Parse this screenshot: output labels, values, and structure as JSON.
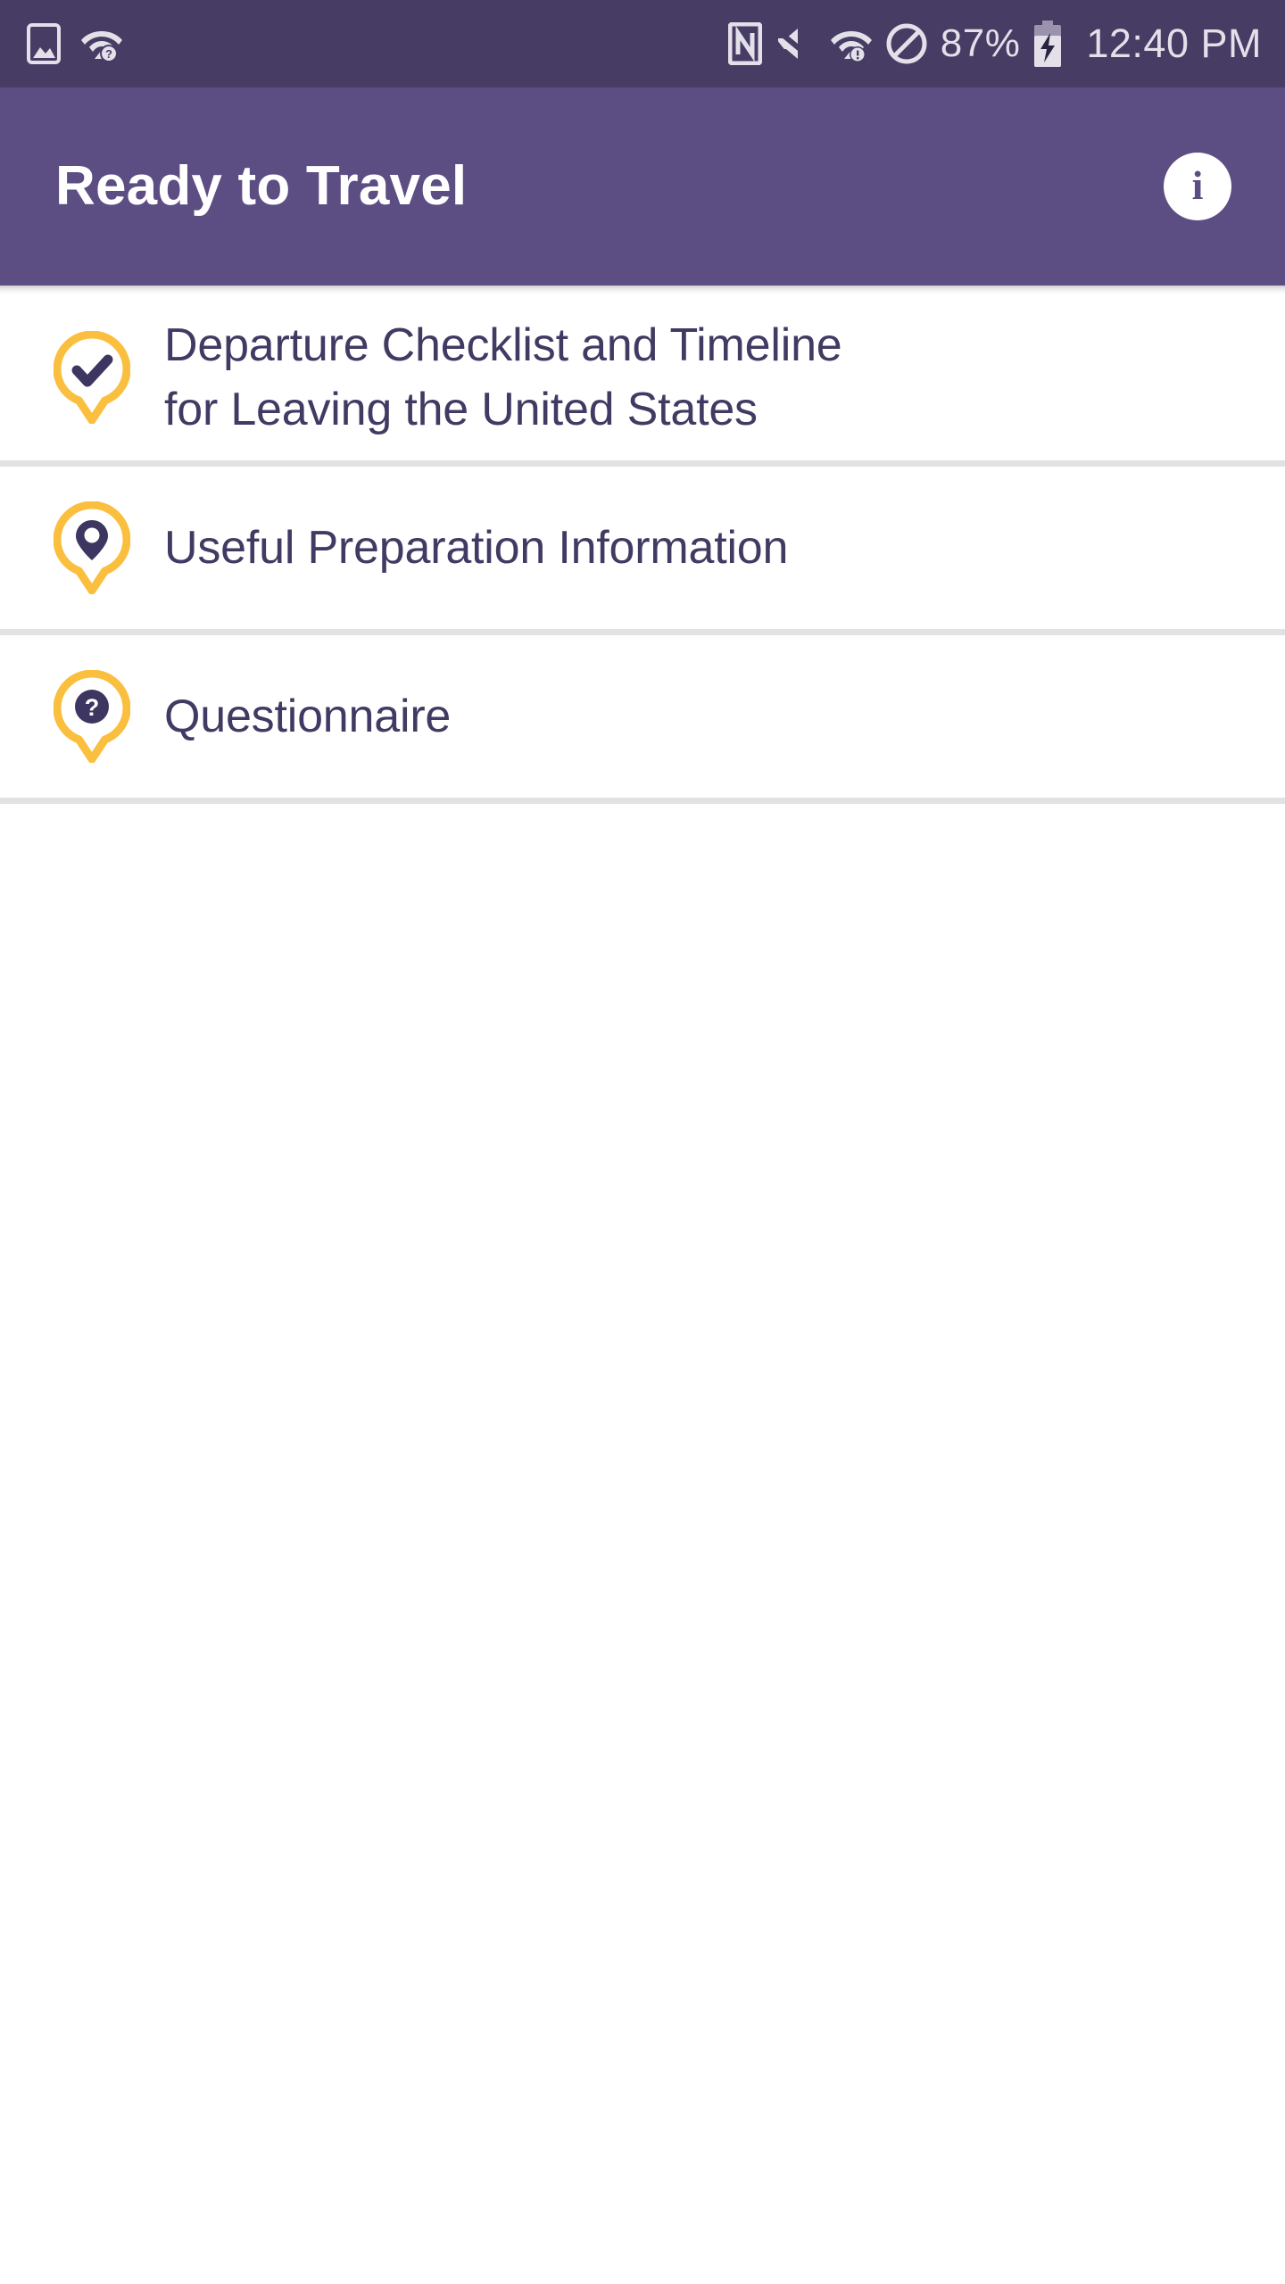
{
  "status_bar": {
    "left_icons": [
      {
        "name": "photo-image-icon",
        "label": "image"
      },
      {
        "name": "wifi-question-icon",
        "label": "wifi-help"
      }
    ],
    "right_icons": [
      {
        "name": "nfc-icon",
        "label": "NFC"
      },
      {
        "name": "volume-mute-icon",
        "label": "muted"
      },
      {
        "name": "wifi-warning-icon",
        "label": "wifi-alert"
      },
      {
        "name": "do-not-disturb-icon",
        "label": "do-not-disturb"
      }
    ],
    "battery_percent": "87%",
    "battery_charging": true,
    "time": "12:40 PM"
  },
  "app_bar": {
    "title": "Ready to Travel",
    "info_glyph": "i",
    "info_action_name": "info"
  },
  "list": {
    "items": [
      {
        "icon": "pin-check-icon",
        "line1": "Departure Checklist and Timeline",
        "line2": "for Leaving the United States"
      },
      {
        "icon": "pin-location-icon",
        "line1": "Useful Preparation Information",
        "line2": ""
      },
      {
        "icon": "pin-question-icon",
        "line1": "Questionnaire",
        "line2": ""
      }
    ]
  },
  "colors": {
    "status_bar_bg": "#473c63",
    "app_bar_bg": "#5c4d83",
    "accent_pin": "#fbbf3f",
    "text_primary": "#413a63",
    "divider": "#e2e2e2",
    "page_bg": "#ffffff"
  }
}
